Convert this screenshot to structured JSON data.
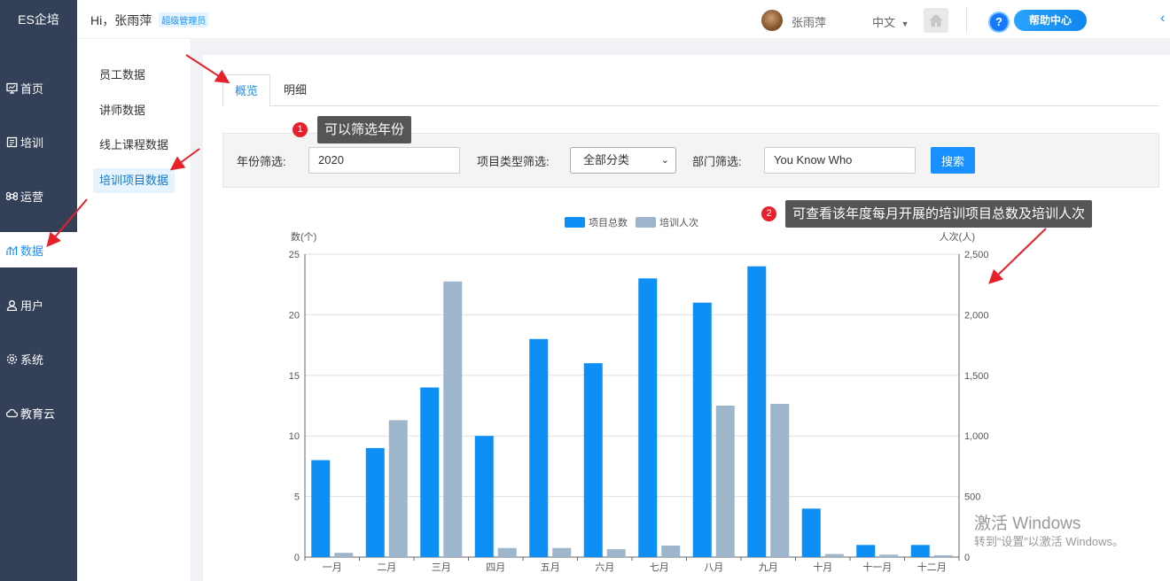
{
  "sidebar": {
    "brand": "ES企培",
    "items": [
      {
        "label": "首页",
        "icon": "monitor-icon"
      },
      {
        "label": "培训",
        "icon": "book-icon"
      },
      {
        "label": "运营",
        "icon": "command-icon"
      },
      {
        "label": "数据",
        "icon": "chart-icon",
        "active": true
      },
      {
        "label": "用户",
        "icon": "user-icon"
      },
      {
        "label": "系统",
        "icon": "gear-icon"
      },
      {
        "label": "教育云",
        "icon": "cloud-icon"
      }
    ]
  },
  "submenu": {
    "items": [
      {
        "label": "员工数据"
      },
      {
        "label": "讲师数据"
      },
      {
        "label": "线上课程数据"
      },
      {
        "label": "培训项目数据",
        "active": true
      }
    ]
  },
  "header": {
    "greeting": "Hi，张雨萍",
    "role_badge": "超级管理员",
    "username": "张雨萍",
    "language": "中文",
    "help_center": "帮助中心"
  },
  "tabs": [
    {
      "label": "概览",
      "active": true
    },
    {
      "label": "明细"
    }
  ],
  "filters": {
    "year_label": "年份筛选:",
    "year_value": "2020",
    "type_label": "项目类型筛选:",
    "type_value": "全部分类",
    "dept_label": "部门筛选:",
    "dept_value": "You Know Who",
    "search_button": "搜索"
  },
  "annotations": [
    {
      "number": "1",
      "text": "可以筛选年份"
    },
    {
      "number": "2",
      "text": "可查看该年度每月开展的培训项目总数及培训人次"
    }
  ],
  "chart_data": {
    "type": "bar",
    "categories": [
      "一月",
      "二月",
      "三月",
      "四月",
      "五月",
      "六月",
      "七月",
      "八月",
      "九月",
      "十月",
      "十一月",
      "十二月"
    ],
    "series": [
      {
        "name": "项目总数",
        "axis": "left",
        "color": "#0d8ff5",
        "values": [
          8,
          9,
          14,
          10,
          18,
          16,
          23,
          21,
          24,
          4,
          1,
          1
        ]
      },
      {
        "name": "培训人次",
        "axis": "right",
        "color": "#9eb6cc",
        "values": [
          35,
          1130,
          2275,
          75,
          75,
          65,
          95,
          1250,
          1265,
          25,
          20,
          15
        ]
      }
    ],
    "y_left": {
      "label": "数(个)",
      "min": 0,
      "max": 25,
      "ticks": [
        "0",
        "5",
        "10",
        "15",
        "20",
        "25"
      ]
    },
    "y_right": {
      "label": "人次(人)",
      "min": 0,
      "max": 2500,
      "ticks": [
        "0",
        "500",
        "1,000",
        "1,500",
        "2,000",
        "2,500"
      ]
    },
    "legend_position": "top-center",
    "grid": true
  },
  "watermark": {
    "title": "激活 Windows",
    "subtitle": "转到“设置”以激活 Windows。"
  }
}
